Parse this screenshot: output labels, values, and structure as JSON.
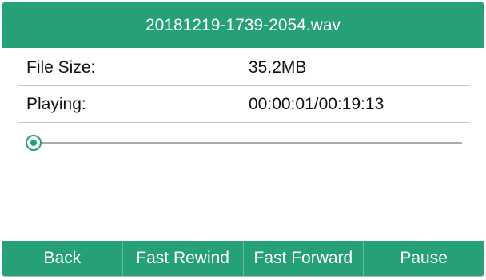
{
  "title_bar": {
    "filename": "20181219-1739-2054.wav"
  },
  "file_size": {
    "label": "File Size:",
    "value": "35.2MB"
  },
  "playing": {
    "label": "Playing:",
    "value": "00:00:01/00:19:13",
    "progress_fraction": 0.0009
  },
  "softkeys": [
    {
      "label": "Back"
    },
    {
      "label": "Fast Rewind"
    },
    {
      "label": "Fast Forward"
    },
    {
      "label": "Pause"
    }
  ],
  "colors": {
    "accent": "#26a076",
    "track": "#a8a8a8"
  }
}
